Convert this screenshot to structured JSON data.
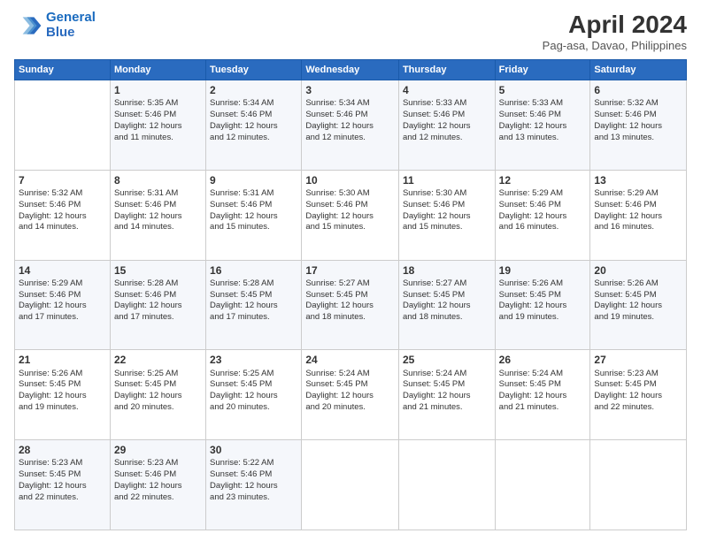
{
  "header": {
    "logo_line1": "General",
    "logo_line2": "Blue",
    "month_title": "April 2024",
    "location": "Pag-asa, Davao, Philippines"
  },
  "days_of_week": [
    "Sunday",
    "Monday",
    "Tuesday",
    "Wednesday",
    "Thursday",
    "Friday",
    "Saturday"
  ],
  "weeks": [
    [
      {
        "day": "",
        "info": ""
      },
      {
        "day": "1",
        "info": "Sunrise: 5:35 AM\nSunset: 5:46 PM\nDaylight: 12 hours\nand 11 minutes."
      },
      {
        "day": "2",
        "info": "Sunrise: 5:34 AM\nSunset: 5:46 PM\nDaylight: 12 hours\nand 12 minutes."
      },
      {
        "day": "3",
        "info": "Sunrise: 5:34 AM\nSunset: 5:46 PM\nDaylight: 12 hours\nand 12 minutes."
      },
      {
        "day": "4",
        "info": "Sunrise: 5:33 AM\nSunset: 5:46 PM\nDaylight: 12 hours\nand 12 minutes."
      },
      {
        "day": "5",
        "info": "Sunrise: 5:33 AM\nSunset: 5:46 PM\nDaylight: 12 hours\nand 13 minutes."
      },
      {
        "day": "6",
        "info": "Sunrise: 5:32 AM\nSunset: 5:46 PM\nDaylight: 12 hours\nand 13 minutes."
      }
    ],
    [
      {
        "day": "7",
        "info": "Sunrise: 5:32 AM\nSunset: 5:46 PM\nDaylight: 12 hours\nand 14 minutes."
      },
      {
        "day": "8",
        "info": "Sunrise: 5:31 AM\nSunset: 5:46 PM\nDaylight: 12 hours\nand 14 minutes."
      },
      {
        "day": "9",
        "info": "Sunrise: 5:31 AM\nSunset: 5:46 PM\nDaylight: 12 hours\nand 15 minutes."
      },
      {
        "day": "10",
        "info": "Sunrise: 5:30 AM\nSunset: 5:46 PM\nDaylight: 12 hours\nand 15 minutes."
      },
      {
        "day": "11",
        "info": "Sunrise: 5:30 AM\nSunset: 5:46 PM\nDaylight: 12 hours\nand 15 minutes."
      },
      {
        "day": "12",
        "info": "Sunrise: 5:29 AM\nSunset: 5:46 PM\nDaylight: 12 hours\nand 16 minutes."
      },
      {
        "day": "13",
        "info": "Sunrise: 5:29 AM\nSunset: 5:46 PM\nDaylight: 12 hours\nand 16 minutes."
      }
    ],
    [
      {
        "day": "14",
        "info": "Sunrise: 5:29 AM\nSunset: 5:46 PM\nDaylight: 12 hours\nand 17 minutes."
      },
      {
        "day": "15",
        "info": "Sunrise: 5:28 AM\nSunset: 5:46 PM\nDaylight: 12 hours\nand 17 minutes."
      },
      {
        "day": "16",
        "info": "Sunrise: 5:28 AM\nSunset: 5:45 PM\nDaylight: 12 hours\nand 17 minutes."
      },
      {
        "day": "17",
        "info": "Sunrise: 5:27 AM\nSunset: 5:45 PM\nDaylight: 12 hours\nand 18 minutes."
      },
      {
        "day": "18",
        "info": "Sunrise: 5:27 AM\nSunset: 5:45 PM\nDaylight: 12 hours\nand 18 minutes."
      },
      {
        "day": "19",
        "info": "Sunrise: 5:26 AM\nSunset: 5:45 PM\nDaylight: 12 hours\nand 19 minutes."
      },
      {
        "day": "20",
        "info": "Sunrise: 5:26 AM\nSunset: 5:45 PM\nDaylight: 12 hours\nand 19 minutes."
      }
    ],
    [
      {
        "day": "21",
        "info": "Sunrise: 5:26 AM\nSunset: 5:45 PM\nDaylight: 12 hours\nand 19 minutes."
      },
      {
        "day": "22",
        "info": "Sunrise: 5:25 AM\nSunset: 5:45 PM\nDaylight: 12 hours\nand 20 minutes."
      },
      {
        "day": "23",
        "info": "Sunrise: 5:25 AM\nSunset: 5:45 PM\nDaylight: 12 hours\nand 20 minutes."
      },
      {
        "day": "24",
        "info": "Sunrise: 5:24 AM\nSunset: 5:45 PM\nDaylight: 12 hours\nand 20 minutes."
      },
      {
        "day": "25",
        "info": "Sunrise: 5:24 AM\nSunset: 5:45 PM\nDaylight: 12 hours\nand 21 minutes."
      },
      {
        "day": "26",
        "info": "Sunrise: 5:24 AM\nSunset: 5:45 PM\nDaylight: 12 hours\nand 21 minutes."
      },
      {
        "day": "27",
        "info": "Sunrise: 5:23 AM\nSunset: 5:45 PM\nDaylight: 12 hours\nand 22 minutes."
      }
    ],
    [
      {
        "day": "28",
        "info": "Sunrise: 5:23 AM\nSunset: 5:45 PM\nDaylight: 12 hours\nand 22 minutes."
      },
      {
        "day": "29",
        "info": "Sunrise: 5:23 AM\nSunset: 5:46 PM\nDaylight: 12 hours\nand 22 minutes."
      },
      {
        "day": "30",
        "info": "Sunrise: 5:22 AM\nSunset: 5:46 PM\nDaylight: 12 hours\nand 23 minutes."
      },
      {
        "day": "",
        "info": ""
      },
      {
        "day": "",
        "info": ""
      },
      {
        "day": "",
        "info": ""
      },
      {
        "day": "",
        "info": ""
      }
    ]
  ]
}
